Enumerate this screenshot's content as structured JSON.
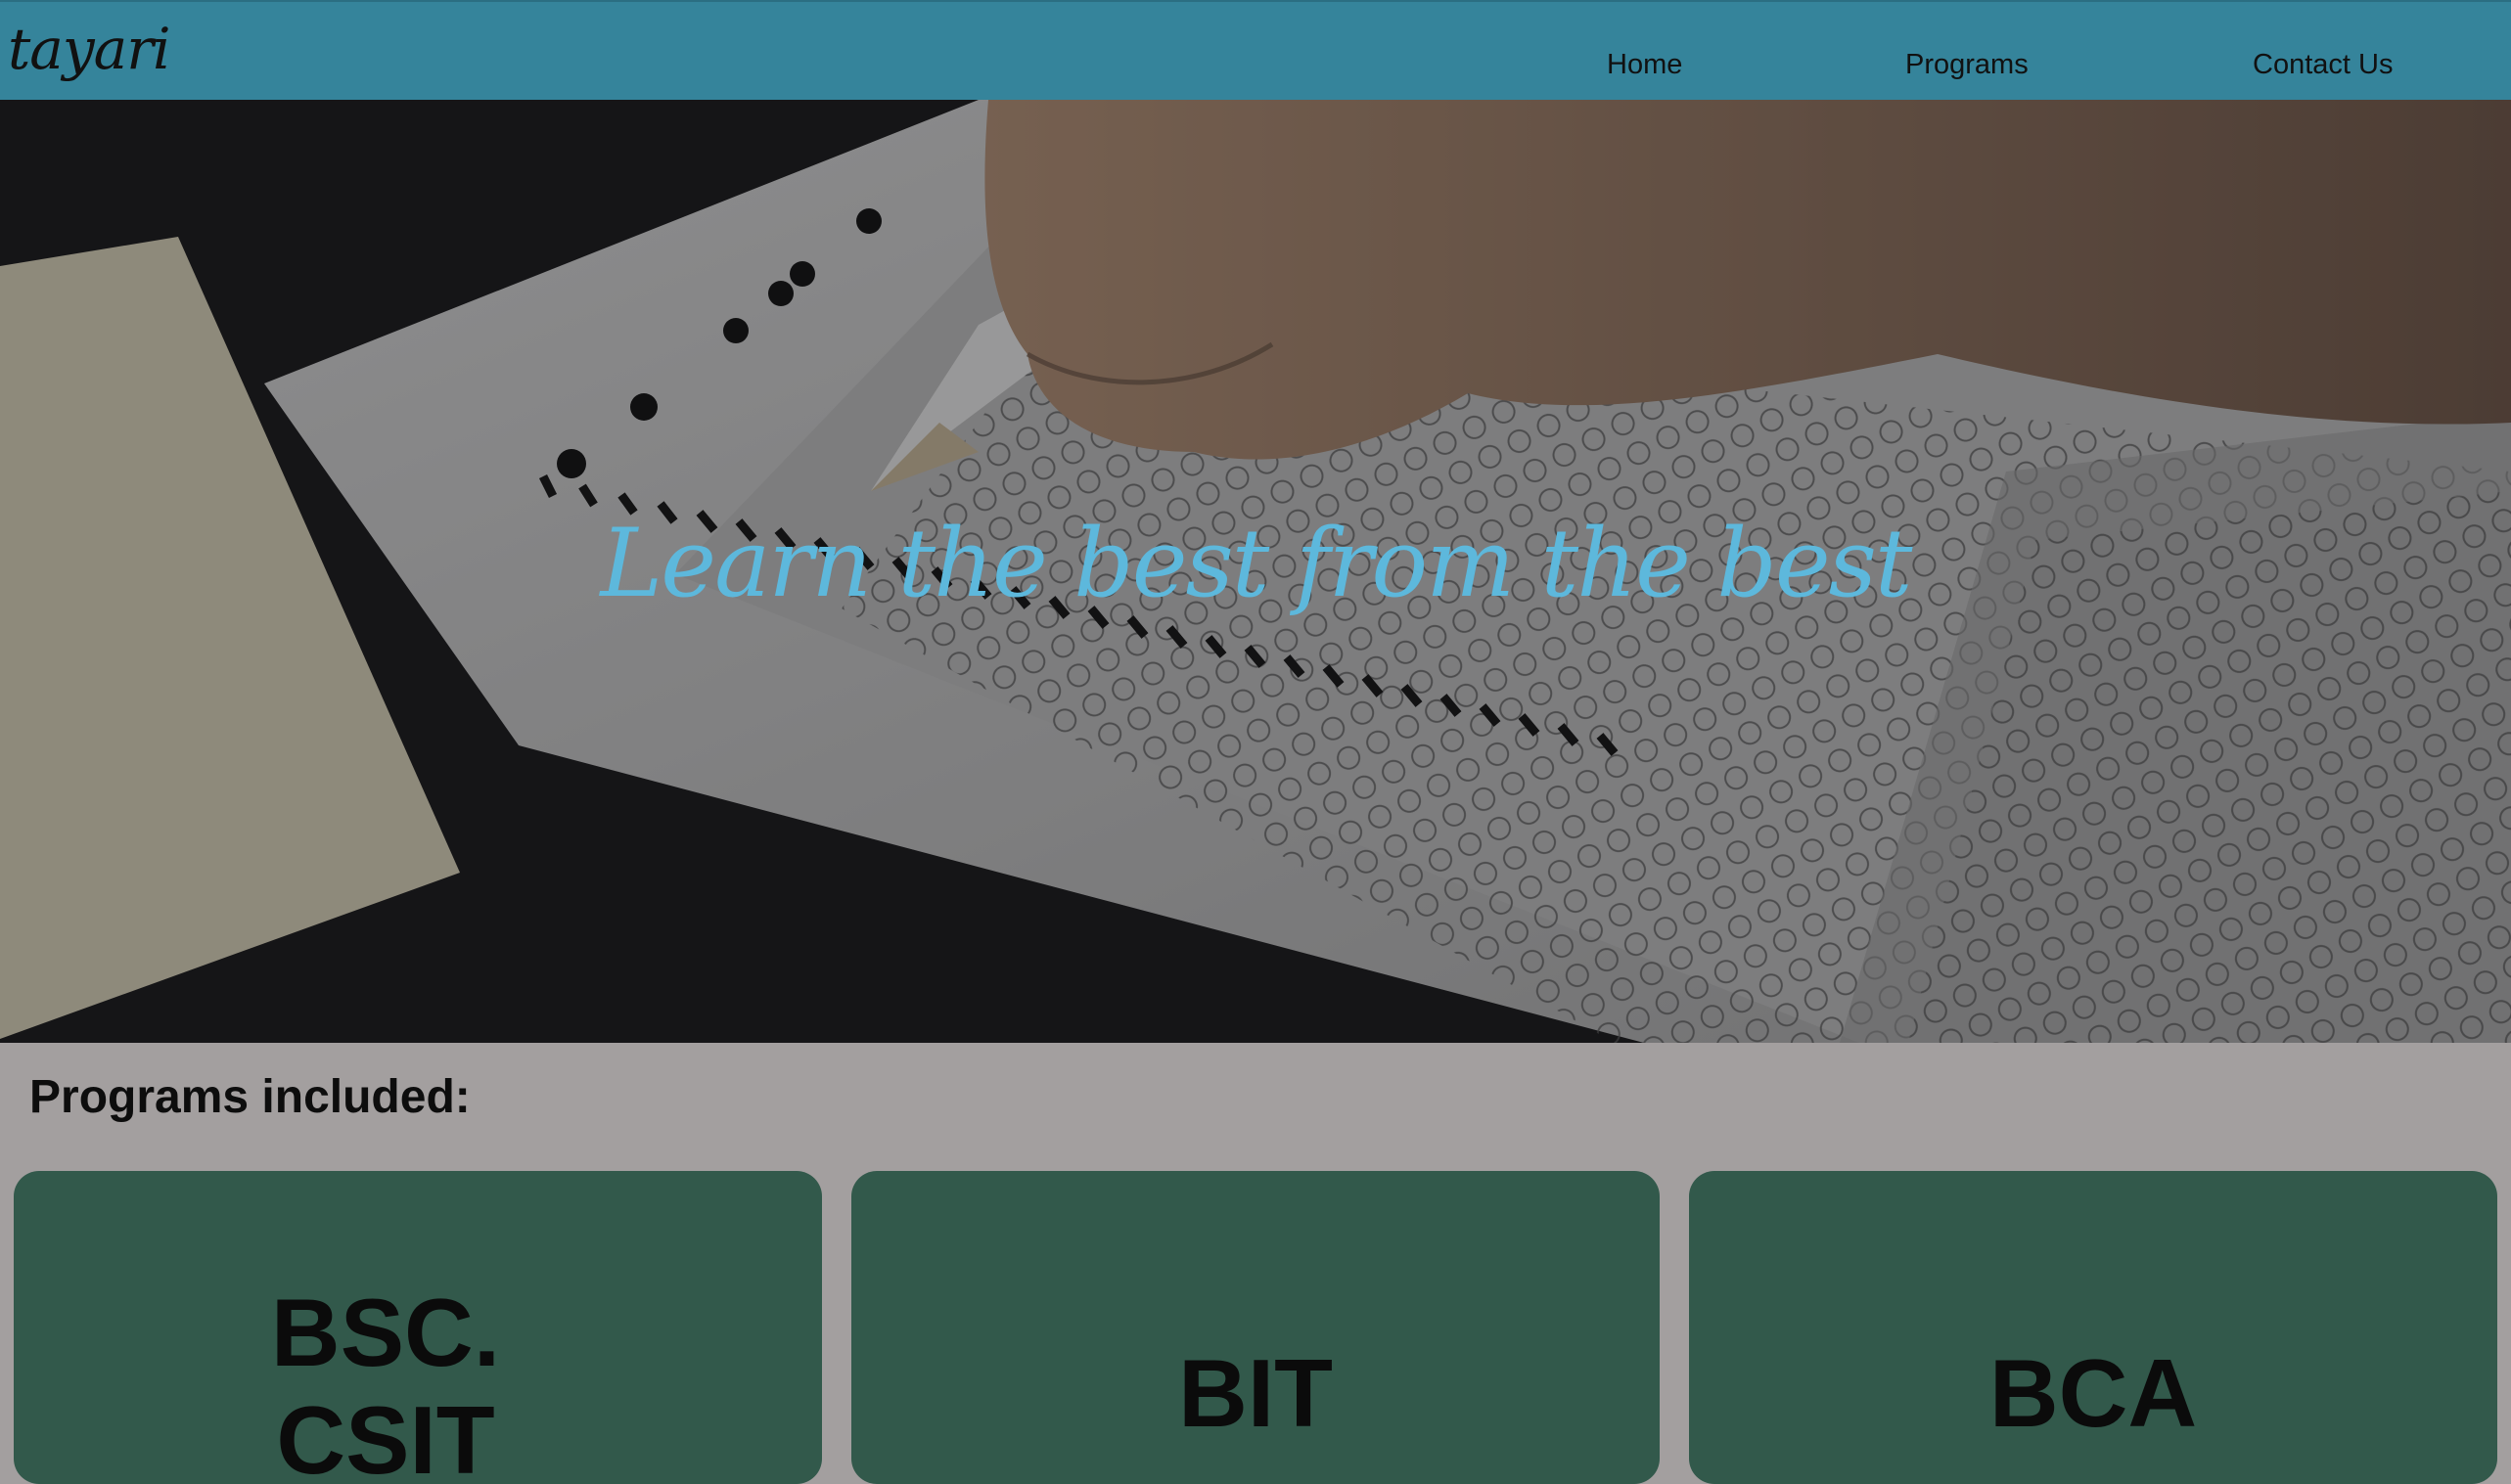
{
  "navbar": {
    "logo": "tayari",
    "links": [
      "Home",
      "Programs",
      "Contact Us"
    ]
  },
  "hero": {
    "title": "Learn the best from the best",
    "title_color": "#5db8dc"
  },
  "programs": {
    "heading": "Programs included:",
    "cards": [
      {
        "label": "BSC.\nCSIT"
      },
      {
        "label": "BIT"
      },
      {
        "label": "BCA"
      }
    ],
    "card_color": "#32594b"
  },
  "colors": {
    "navbar": "#35849b",
    "page_background": "#a39f9f"
  }
}
